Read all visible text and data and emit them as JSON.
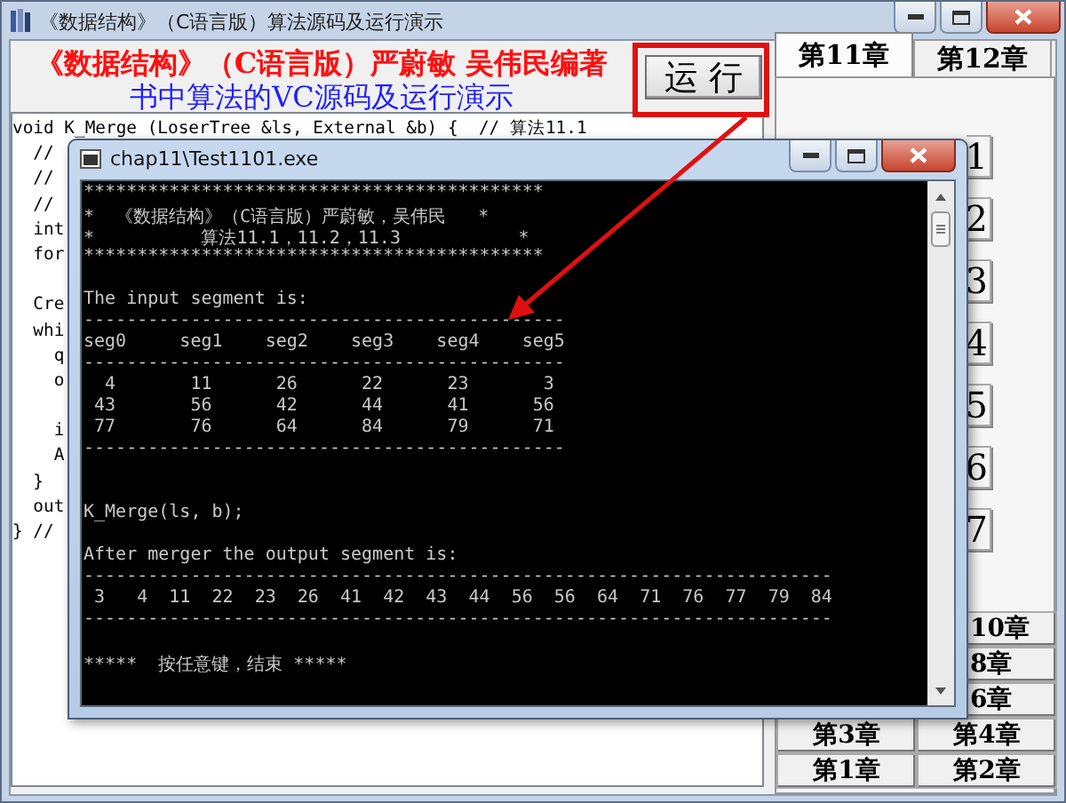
{
  "window": {
    "title": "《数据结构》（C语言版）算法源码及运行演示"
  },
  "header": {
    "title": "《数据结构》（C语言版）严蔚敏  吴伟民编著",
    "subtitle": "书中算法的VC源码及运行演示"
  },
  "run_button": "运 行",
  "code_blocks": [
    [
      "void K_Merge (LoserTree &ls, External &b) {  // 算法11.1",
      "  //",
      "  //",
      "  //",
      "  int",
      "  for"
    ],
    [
      "  Cre",
      "  whi",
      "    q",
      "    o"
    ],
    [
      "    i",
      "    A",
      "  }",
      "  out",
      "} //"
    ]
  ],
  "tabs": [
    {
      "label": "第11章",
      "selected": true
    },
    {
      "label": "第12章",
      "selected": false
    }
  ],
  "algorithm_buttons": [
    "1",
    "2",
    "3",
    "4",
    "5",
    "6",
    "7"
  ],
  "chapter_rows": [
    [
      "10章"
    ],
    [
      "8章"
    ],
    [
      "6章"
    ],
    [
      "第3章",
      "第4章"
    ],
    [
      "第1章",
      "第2章"
    ]
  ],
  "console": {
    "title": "chap11\\Test1101.exe",
    "sections": [
      {
        "kind": "banner",
        "lines": [
          "*******************************************",
          "*  《数据结构》（C语言版）严蔚敏，吴伟民   *",
          "*          算法11.1，11.2，11.3           *",
          "*******************************************"
        ]
      },
      {
        "kind": "text",
        "lines": [
          "The input segment is:",
          "---------------------------------------------",
          "seg0     seg1    seg2    seg3    seg4    seg5",
          "---------------------------------------------",
          "  4       11      26      22      23       3",
          " 43       56      42      44      41      56",
          " 77       76      64      84      79      71",
          "---------------------------------------------"
        ]
      },
      {
        "kind": "call",
        "lines": [
          "K_Merge(ls, b);"
        ]
      },
      {
        "kind": "text",
        "lines": [
          "After merger the output segment is:",
          "----------------------------------------------------------------------",
          " 3   4  11  22  23  26  41  42  43  44  56  56  64  71  76  77  79  84",
          "----------------------------------------------------------------------"
        ]
      },
      {
        "kind": "text",
        "lines": [
          "*****  按任意键，结束 *****"
        ]
      }
    ]
  }
}
